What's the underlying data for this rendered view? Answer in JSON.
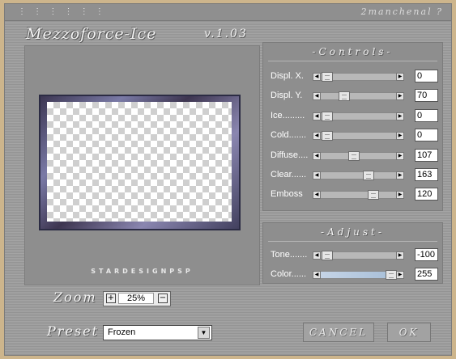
{
  "titlebar": {
    "dots": "⋮ ⋮ ⋮ ⋮ ⋮ ⋮",
    "author": "2manchenal ?"
  },
  "header": {
    "product": "Mezzoforce-Ice",
    "version": "v.1.03"
  },
  "preview": {
    "brand": "STARDESIGNPSP"
  },
  "controls": {
    "title": "-Controls-",
    "items": [
      {
        "label": "Displ. X.",
        "value": "0",
        "position": 0.0
      },
      {
        "label": "Displ. Y.",
        "value": "70",
        "position": 0.27
      },
      {
        "label": "Ice.........",
        "value": "0",
        "position": 0.0
      },
      {
        "label": "Cold.......",
        "value": "0",
        "position": 0.0
      },
      {
        "label": "Diffuse....",
        "value": "107",
        "position": 0.42
      },
      {
        "label": "Clear......",
        "value": "163",
        "position": 0.64
      },
      {
        "label": "Emboss",
        "value": "120",
        "position": 0.72
      }
    ]
  },
  "adjust": {
    "title": "-Adjust-",
    "items": [
      {
        "label": "Tone.......",
        "value": "-100",
        "position": 0.0
      },
      {
        "label": "Color......",
        "value": "255",
        "position": 1.0
      }
    ]
  },
  "zoom": {
    "label": "Zoom",
    "value": "25%",
    "plus": "+",
    "minus": "−"
  },
  "preset": {
    "label": "Preset",
    "value": "Frozen",
    "caret": "▼"
  },
  "buttons": {
    "cancel": "CANCEL",
    "ok": "OK"
  },
  "icons": {
    "left": "◀",
    "right": "▶"
  }
}
